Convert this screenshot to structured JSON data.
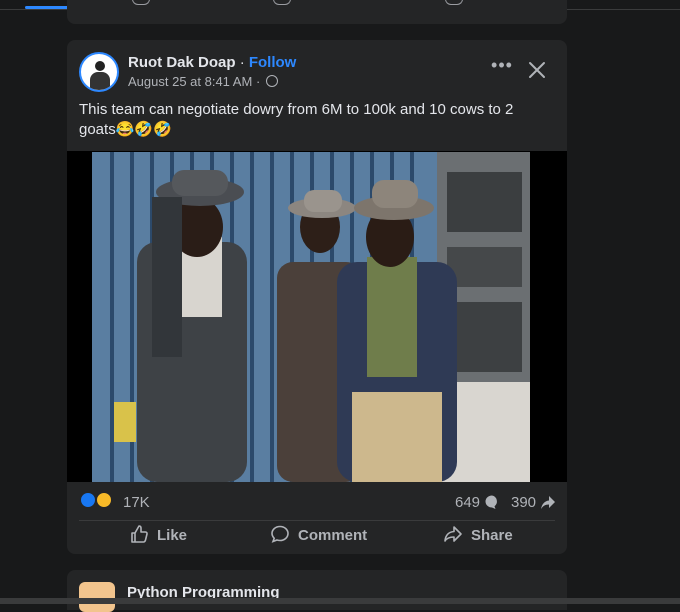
{
  "post": {
    "author": "Ruot Dak Doap",
    "separator": "·",
    "follow": "Follow",
    "timestamp": "August 25 at 8:41 AM",
    "meta_sep": "·",
    "text": "This team can negotiate dowry from 6M to 100k and 10 cows to 2 goats😂🤣🤣",
    "reaction_count": "17K",
    "comment_count": "649",
    "share_count": "390",
    "actions": {
      "like": "Like",
      "comment": "Comment",
      "share": "Share"
    }
  },
  "next_post": {
    "title": "Python Programming"
  },
  "colors": {
    "accent": "#2d88ff",
    "card": "#242526",
    "bg": "#18191a",
    "muted": "#b0b3b8"
  }
}
